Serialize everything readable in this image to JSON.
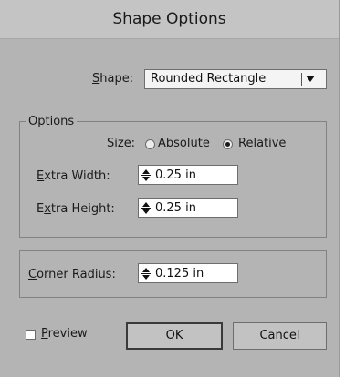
{
  "dialog": {
    "title": "Shape Options",
    "shape": {
      "label_mnemonic": "S",
      "label_rest": "hape:",
      "value": "Rounded Rectangle"
    },
    "options_group": {
      "legend": "Options",
      "size_label": "Size:",
      "size_options": [
        {
          "mnemonic": "A",
          "rest": "bsolute",
          "selected": false
        },
        {
          "mnemonic": "R",
          "rest": "elative",
          "selected": true
        }
      ],
      "extra_width": {
        "label_mnemonic": "E",
        "label_rest": "xtra Width:",
        "value": "0.25 in"
      },
      "extra_height": {
        "label_pre": "E",
        "label_mnemonic": "x",
        "label_rest": "tra Height:",
        "value": "0.25 in"
      }
    },
    "corner_radius": {
      "label_mnemonic": "C",
      "label_rest": "orner Radius:",
      "value": "0.125 in"
    },
    "preview": {
      "label_mnemonic": "P",
      "label_rest": "review",
      "checked": false
    },
    "buttons": {
      "ok": "OK",
      "cancel": "Cancel"
    }
  },
  "colors": {
    "dialog_bg": "#b4b4b4",
    "titlebar_bg": "#c4c4c4",
    "field_bg": "#ffffff",
    "border": "#6e6e6e"
  }
}
